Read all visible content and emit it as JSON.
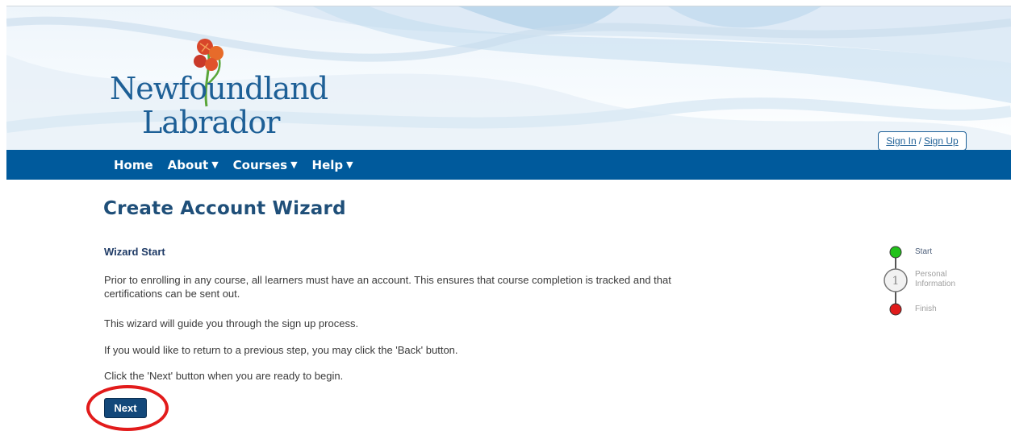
{
  "header": {
    "logo": {
      "line1": "Newfoundland",
      "line2": "Labrador"
    },
    "auth": {
      "sign_in": "Sign In",
      "separator": "/",
      "sign_up": "Sign Up"
    }
  },
  "nav": {
    "items": [
      {
        "label": "Home"
      },
      {
        "label": "About",
        "caret": "▼"
      },
      {
        "label": "Courses",
        "caret": "▼"
      },
      {
        "label": "Help",
        "caret": "▼"
      }
    ]
  },
  "page": {
    "title": "Create Account Wizard"
  },
  "wizard": {
    "heading": "Wizard Start",
    "paragraphs": [
      "Prior to enrolling in any course, all learners must have an account. This ensures that course completion is tracked and that certifications can be sent out.",
      "This wizard will guide you through the sign up process.",
      "If you would like to return to a previous step, you may click the 'Back' button.",
      "Click the 'Next' button when you are ready to begin."
    ],
    "next_label": "Next"
  },
  "steps": [
    {
      "label": "Start",
      "marker": "",
      "color": "#22c21a"
    },
    {
      "label": "Personal Information",
      "marker": "1",
      "color": "#f2f2f2"
    },
    {
      "label": "Finish",
      "marker": "",
      "color": "#e01b1b"
    }
  ],
  "colors": {
    "brand": "#005a9c",
    "title": "#1f4f79",
    "button": "#13487a",
    "highlight": "#e21b1b"
  }
}
